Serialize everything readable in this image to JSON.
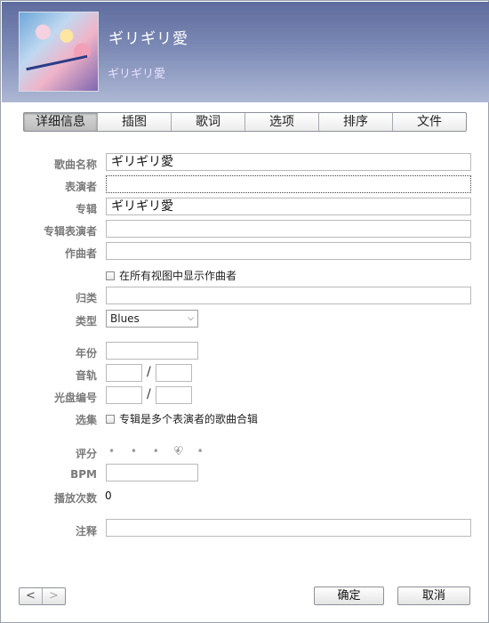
{
  "header": {
    "title": "ギリギリ愛",
    "album": "ギリギリ愛",
    "artwork_icon": "album-artwork"
  },
  "tabs": [
    {
      "label": "详细信息",
      "active": true
    },
    {
      "label": "插图",
      "active": false
    },
    {
      "label": "歌词",
      "active": false
    },
    {
      "label": "选项",
      "active": false
    },
    {
      "label": "排序",
      "active": false
    },
    {
      "label": "文件",
      "active": false
    }
  ],
  "form": {
    "song_name": {
      "label": "歌曲名称",
      "value": "ギリギリ愛"
    },
    "artist": {
      "label": "表演者",
      "value": ""
    },
    "album": {
      "label": "专辑",
      "value": "ギリギリ愛"
    },
    "album_artist": {
      "label": "专辑表演者",
      "value": ""
    },
    "composer": {
      "label": "作曲者",
      "value": ""
    },
    "show_composer": {
      "label": "在所有视图中显示作曲者",
      "checked": false
    },
    "grouping": {
      "label": "归类",
      "value": ""
    },
    "genre": {
      "label": "类型",
      "value": "Blues"
    },
    "year": {
      "label": "年份",
      "value": ""
    },
    "track": {
      "label": "音轨",
      "number": "",
      "total": "",
      "separator": "/"
    },
    "disc": {
      "label": "光盘编号",
      "number": "",
      "total": "",
      "separator": "/"
    },
    "compilation": {
      "label": "选集",
      "checkbox_label": "专辑是多个表演者的歌曲合辑",
      "checked": false
    },
    "rating": {
      "label": "评分",
      "dots": "• • • • •",
      "heart": "♡",
      "value": 0
    },
    "bpm": {
      "label": "BPM",
      "value": ""
    },
    "play_count": {
      "label": "播放次数",
      "value": "0"
    },
    "comments": {
      "label": "注释",
      "value": ""
    }
  },
  "footer": {
    "prev": "<",
    "next": ">",
    "ok": "确定",
    "cancel": "取消"
  }
}
